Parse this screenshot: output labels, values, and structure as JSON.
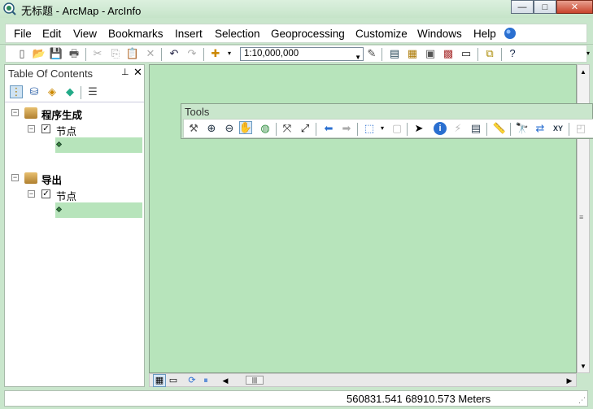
{
  "window": {
    "title": "无标题 - ArcMap - ArcInfo",
    "minimize": "—",
    "maximize": "□",
    "close": "✕"
  },
  "menu": {
    "items": [
      {
        "label": "File"
      },
      {
        "label": "Edit"
      },
      {
        "label": "View"
      },
      {
        "label": "Bookmarks"
      },
      {
        "label": "Insert"
      },
      {
        "label": "Selection"
      },
      {
        "label": "Geoprocessing"
      },
      {
        "label": "Customize"
      },
      {
        "label": "Windows"
      },
      {
        "label": "Help"
      }
    ]
  },
  "toolbar": {
    "scale": "1:10,000,000"
  },
  "toc": {
    "title": "Table Of Contents",
    "pin": "📌",
    "close": "✕",
    "groups": [
      {
        "name": "程序生成",
        "expand": "⊟",
        "layer": {
          "name": "节点",
          "expand": "⊟",
          "checked": "✓"
        }
      },
      {
        "name": "导出",
        "expand": "⊟",
        "layer": {
          "name": "节点",
          "expand": "⊟",
          "checked": "✓"
        }
      }
    ]
  },
  "tools_window": {
    "title": "Tools"
  },
  "status": {
    "coordinates": "560831.541  68910.573 Meters"
  },
  "colors": {
    "chrome": "#c9e6cc",
    "map_bg": "#b7e4bb",
    "accent": "#2a6fd0"
  }
}
